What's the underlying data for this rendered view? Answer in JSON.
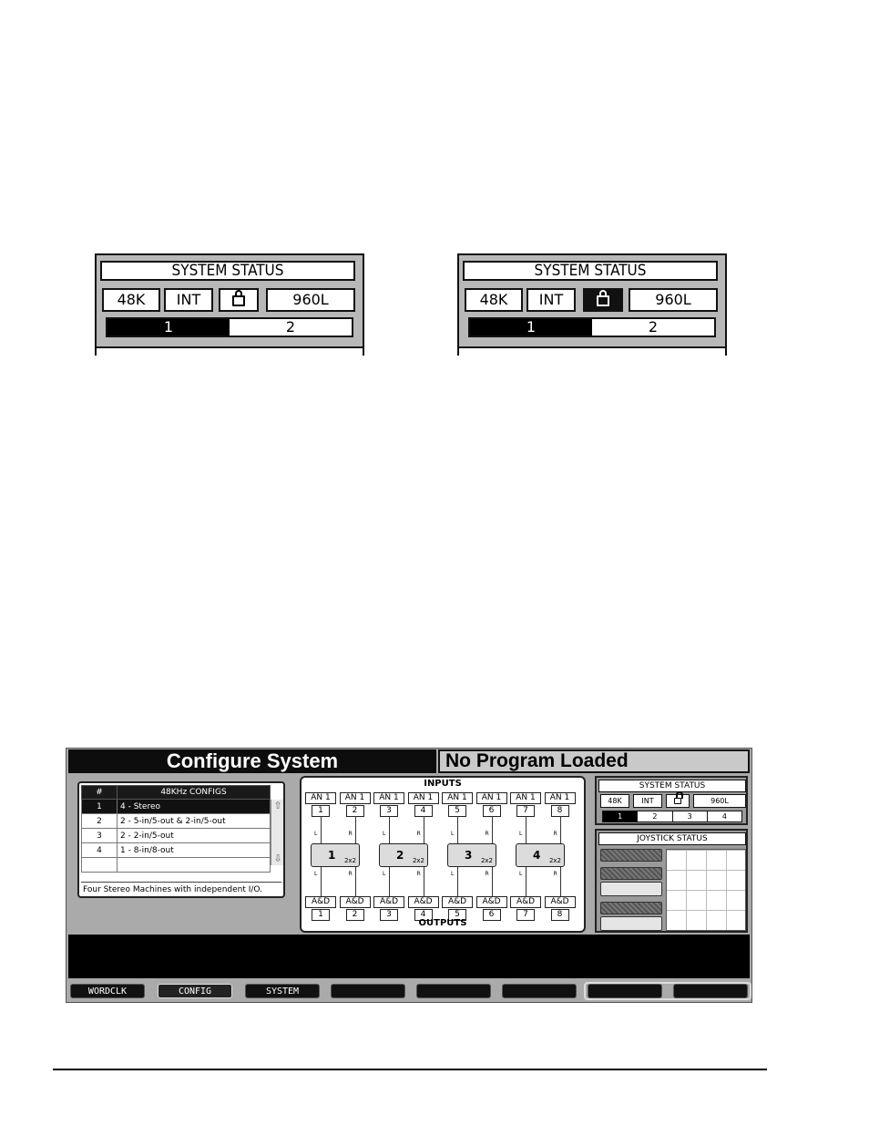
{
  "status_panels": [
    {
      "title": "SYSTEM STATUS",
      "rate": "48K",
      "clock": "INT",
      "lock": "lock-icon",
      "lock_engaged": false,
      "model": "960L",
      "machines": [
        {
          "label": "1",
          "active": true
        },
        {
          "label": "2",
          "active": false
        }
      ]
    },
    {
      "title": "SYSTEM STATUS",
      "rate": "48K",
      "clock": "INT",
      "lock": "lock-icon",
      "lock_engaged": true,
      "model": "960L",
      "machines": [
        {
          "label": "1",
          "active": true
        },
        {
          "label": "2",
          "active": false
        }
      ]
    }
  ],
  "screen": {
    "title": "Configure System",
    "program_status": "No Program Loaded",
    "configs": {
      "col_num": "#",
      "col_name": "48KHz CONFIGS",
      "rows": [
        {
          "num": "1",
          "name": "4 - Stereo",
          "selected": true
        },
        {
          "num": "2",
          "name": "2 - 5-in/5-out & 2-in/5-out",
          "selected": false
        },
        {
          "num": "3",
          "name": "2 - 2-in/5-out",
          "selected": false
        },
        {
          "num": "4",
          "name": "1 - 8-in/8-out",
          "selected": false
        },
        {
          "num": "",
          "name": "",
          "selected": false
        }
      ],
      "scroll_up": "arrow-up-icon",
      "scroll_down": "arrow-down-icon",
      "description": "Four Stereo Machines with independent I/O."
    },
    "routing": {
      "inputs_label": "INPUTS",
      "outputs_label": "OUTPUTS",
      "inputs": [
        {
          "type": "AN 1",
          "num": "1"
        },
        {
          "type": "AN 1",
          "num": "2"
        },
        {
          "type": "AN 1",
          "num": "3"
        },
        {
          "type": "AN 1",
          "num": "4"
        },
        {
          "type": "AN 1",
          "num": "5"
        },
        {
          "type": "AN 1",
          "num": "6"
        },
        {
          "type": "AN 1",
          "num": "7"
        },
        {
          "type": "AN 1",
          "num": "8"
        }
      ],
      "machines": [
        {
          "num": "1",
          "size": "2x2"
        },
        {
          "num": "2",
          "size": "2x2"
        },
        {
          "num": "3",
          "size": "2x2"
        },
        {
          "num": "4",
          "size": "2x2"
        }
      ],
      "channel_left": "L",
      "channel_right": "R",
      "outputs": [
        {
          "type": "A&D",
          "num": "1"
        },
        {
          "type": "A&D",
          "num": "2"
        },
        {
          "type": "A&D",
          "num": "3"
        },
        {
          "type": "A&D",
          "num": "4"
        },
        {
          "type": "A&D",
          "num": "5"
        },
        {
          "type": "A&D",
          "num": "6"
        },
        {
          "type": "A&D",
          "num": "7"
        },
        {
          "type": "A&D",
          "num": "8"
        }
      ]
    },
    "system_status": {
      "title": "SYSTEM STATUS",
      "rate": "48K",
      "clock": "INT",
      "lock": "lock-icon",
      "model": "960L",
      "machines": [
        {
          "label": "1",
          "active": true
        },
        {
          "label": "2",
          "active": false
        },
        {
          "label": "3",
          "active": false
        },
        {
          "label": "4",
          "active": false
        }
      ]
    },
    "joystick_status": {
      "title": "JOYSTICK STATUS"
    },
    "softkeys": [
      {
        "label": "WORDCLK",
        "selected": false
      },
      {
        "label": "CONFIG",
        "selected": true
      },
      {
        "label": "SYSTEM",
        "selected": false
      },
      {
        "label": "",
        "selected": false
      },
      {
        "label": "",
        "selected": false
      },
      {
        "label": "",
        "selected": false
      },
      {
        "label": "",
        "selected": false
      },
      {
        "label": "",
        "selected": false
      }
    ]
  }
}
